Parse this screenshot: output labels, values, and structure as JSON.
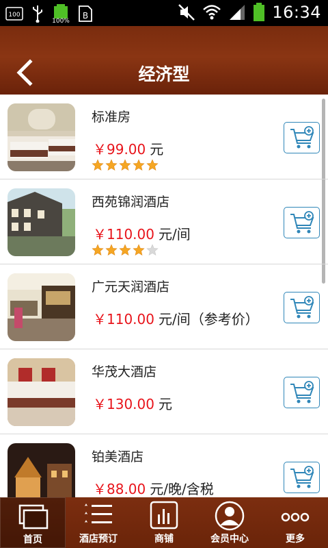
{
  "status_bar": {
    "time": "16:34",
    "battery_label": "100%",
    "left_icons": [
      "sd-card-100-icon",
      "usb-icon",
      "battery-full-icon",
      "news-icon"
    ],
    "right_icons": [
      "mute-icon",
      "wifi-icon",
      "signal-icon",
      "battery-icon"
    ]
  },
  "header": {
    "title": "经济型",
    "back_icon": "chevron-left-icon"
  },
  "hotels": [
    {
      "name": "标准房",
      "price": "￥99.00",
      "unit": "元",
      "stars": 5,
      "thumb": "room"
    },
    {
      "name": "西苑锦润酒店",
      "price": "￥110.00",
      "unit": "元/间",
      "stars": 4,
      "thumb": "street"
    },
    {
      "name": "广元天润酒店",
      "price": "￥110.00",
      "unit": "元/间（参考价）",
      "stars": 0,
      "thumb": "lobby"
    },
    {
      "name": "华茂大酒店",
      "price": "￥130.00",
      "unit": "元",
      "stars": 0,
      "thumb": "bed"
    },
    {
      "name": "铂美酒店",
      "price": "￥88.00",
      "unit": "元/晚/含税",
      "stars": 0,
      "thumb": "night"
    }
  ],
  "colors": {
    "accent": "#7a2c0e",
    "price": "#e8141b",
    "cart_border": "#2f86b8",
    "star": "#f5a623"
  },
  "nav": [
    {
      "label": "首页",
      "icon": "home-windows-icon",
      "active": true
    },
    {
      "label": "酒店预订",
      "icon": "star-list-icon",
      "active": false
    },
    {
      "label": "商铺",
      "icon": "shop-bars-icon",
      "active": false
    },
    {
      "label": "会员中心",
      "icon": "user-avatar-icon",
      "active": false
    },
    {
      "label": "更多",
      "icon": "more-dots-icon",
      "active": false
    }
  ]
}
